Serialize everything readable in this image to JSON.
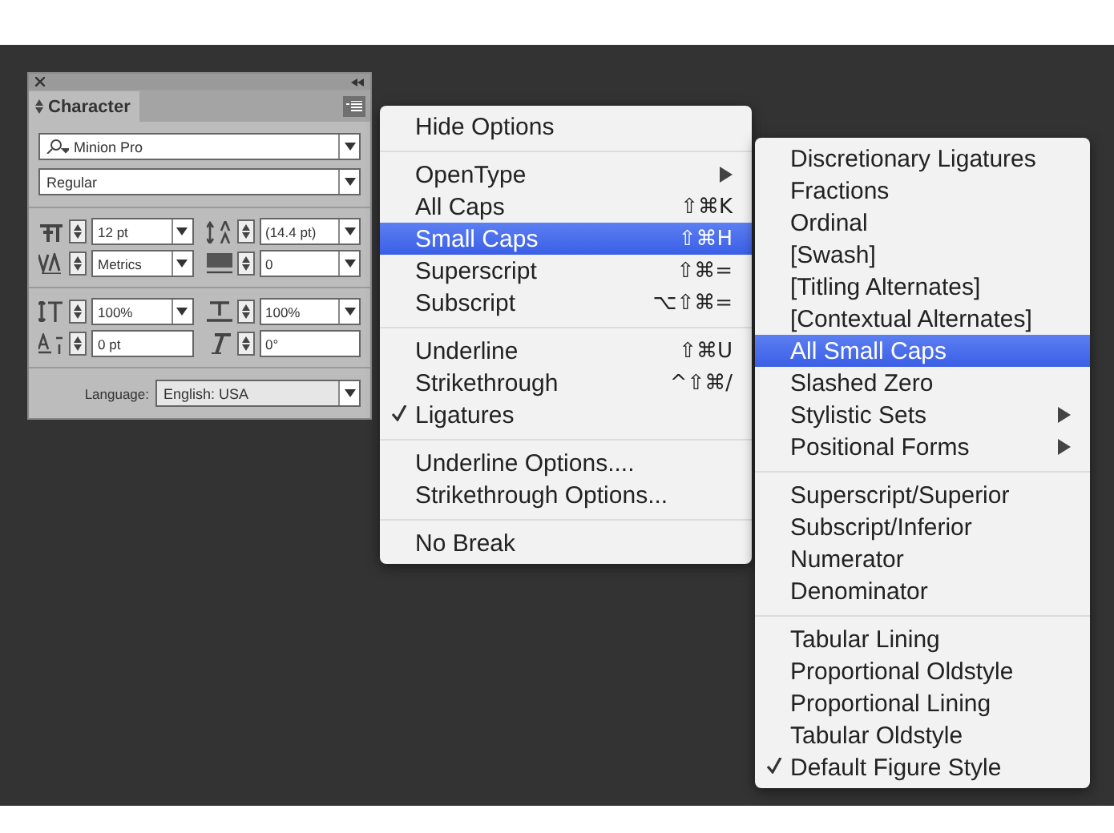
{
  "panel": {
    "tab": {
      "label": "Character",
      "selected": true
    },
    "font": {
      "value": "Minion Pro"
    },
    "style": {
      "value": "Regular"
    },
    "fields": [
      {
        "kind": "dropdown",
        "value": "12 pt"
      },
      {
        "kind": "dropdown",
        "value": "(14.4 pt)"
      },
      {
        "kind": "dropdown",
        "value": "Metrics"
      },
      {
        "kind": "dropdown",
        "value": "0"
      },
      {
        "kind": "dropdown",
        "value": "100%"
      },
      {
        "kind": "dropdown",
        "value": "100%"
      },
      {
        "kind": "text",
        "value": "0 pt"
      },
      {
        "kind": "text",
        "value": "0°"
      }
    ],
    "language": {
      "label": "Language:",
      "value": "English: USA"
    }
  },
  "menu": {
    "groups": [
      [
        {
          "label": "Hide Options",
          "checked": false,
          "selected": false
        }
      ],
      [
        {
          "label": "OpenType",
          "submenu": true,
          "checked": false,
          "selected": false
        },
        {
          "label": "All Caps",
          "shortcut": "⇧⌘K",
          "checked": false,
          "selected": false
        },
        {
          "label": "Small Caps",
          "shortcut": "⇧⌘H",
          "checked": false,
          "selected": true
        },
        {
          "label": "Superscript",
          "shortcut": "⇧⌘=",
          "checked": false,
          "selected": false
        },
        {
          "label": "Subscript",
          "shortcut": "⌥⇧⌘=",
          "checked": false,
          "selected": false
        }
      ],
      [
        {
          "label": "Underline",
          "shortcut": "⇧⌘U",
          "checked": false,
          "selected": false
        },
        {
          "label": "Strikethrough",
          "shortcut": "^⇧⌘/",
          "checked": false,
          "selected": false
        },
        {
          "label": "Ligatures",
          "checked": true,
          "selected": false
        }
      ],
      [
        {
          "label": "Underline Options....",
          "checked": false,
          "selected": false
        },
        {
          "label": "Strikethrough Options...",
          "checked": false,
          "selected": false
        }
      ],
      [
        {
          "label": "No Break",
          "checked": false,
          "selected": false
        }
      ]
    ]
  },
  "submenu": {
    "groups": [
      [
        {
          "label": "Discretionary Ligatures",
          "checked": false,
          "selected": false
        },
        {
          "label": "Fractions",
          "checked": false,
          "selected": false
        },
        {
          "label": "Ordinal",
          "checked": false,
          "selected": false
        },
        {
          "label": "[Swash]",
          "checked": false,
          "selected": false
        },
        {
          "label": "[Titling Alternates]",
          "checked": false,
          "selected": false
        },
        {
          "label": "[Contextual Alternates]",
          "checked": false,
          "selected": false
        },
        {
          "label": "All Small Caps",
          "checked": false,
          "selected": true
        },
        {
          "label": "Slashed Zero",
          "checked": false,
          "selected": false
        },
        {
          "label": "Stylistic Sets",
          "submenu": true,
          "checked": false,
          "selected": false
        },
        {
          "label": "Positional Forms",
          "submenu": true,
          "checked": false,
          "selected": false
        }
      ],
      [
        {
          "label": "Superscript/Superior",
          "checked": false,
          "selected": false
        },
        {
          "label": "Subscript/Inferior",
          "checked": false,
          "selected": false
        },
        {
          "label": "Numerator",
          "checked": false,
          "selected": false
        },
        {
          "label": "Denominator",
          "checked": false,
          "selected": false
        }
      ],
      [
        {
          "label": "Tabular Lining",
          "checked": false,
          "selected": false
        },
        {
          "label": "Proportional Oldstyle",
          "checked": false,
          "selected": false
        },
        {
          "label": "Proportional Lining",
          "checked": false,
          "selected": false
        },
        {
          "label": "Tabular Oldstyle",
          "checked": false,
          "selected": false
        },
        {
          "label": "Default Figure Style",
          "checked": true,
          "selected": false
        }
      ]
    ]
  }
}
